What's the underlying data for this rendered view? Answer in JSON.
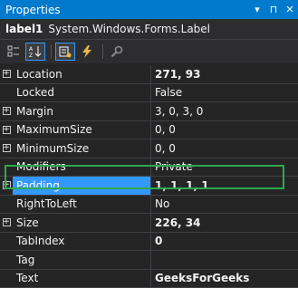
{
  "window": {
    "title": "Properties",
    "buttons": [
      "▾",
      "⊓",
      "✕"
    ]
  },
  "object": {
    "name": "label1",
    "type": "System.Windows.Forms.Label"
  },
  "toolbar": {
    "icons": [
      "categorized-icon",
      "alphabetical-icon",
      "properties-icon",
      "events-icon",
      "property-pages-icon"
    ]
  },
  "properties": [
    {
      "name": "Location",
      "value": "271, 93",
      "expandable": true,
      "bold": true
    },
    {
      "name": "Locked",
      "value": "False",
      "expandable": false,
      "bold": false
    },
    {
      "name": "Margin",
      "value": "3, 0, 3, 0",
      "expandable": true,
      "bold": false
    },
    {
      "name": "MaximumSize",
      "value": "0, 0",
      "expandable": true,
      "bold": false
    },
    {
      "name": "MinimumSize",
      "value": "0, 0",
      "expandable": true,
      "bold": false
    },
    {
      "name": "Modifiers",
      "value": "Private",
      "expandable": false,
      "bold": false
    },
    {
      "name": "Padding",
      "value": "1, 1, 1, 1",
      "expandable": true,
      "bold": true
    },
    {
      "name": "RightToLeft",
      "value": "No",
      "expandable": false,
      "bold": false
    },
    {
      "name": "Size",
      "value": "226, 34",
      "expandable": true,
      "bold": true
    },
    {
      "name": "TabIndex",
      "value": "0",
      "expandable": false,
      "bold": true
    },
    {
      "name": "Tag",
      "value": "",
      "expandable": false,
      "bold": false
    },
    {
      "name": "Text",
      "value": "GeeksForGeeks",
      "expandable": false,
      "bold": true
    }
  ],
  "selected_property": "Padding",
  "colors": {
    "title_bar": "#007acc",
    "selection": "#3399ff",
    "highlight_box": "#2fa84f",
    "background": "#252526"
  }
}
